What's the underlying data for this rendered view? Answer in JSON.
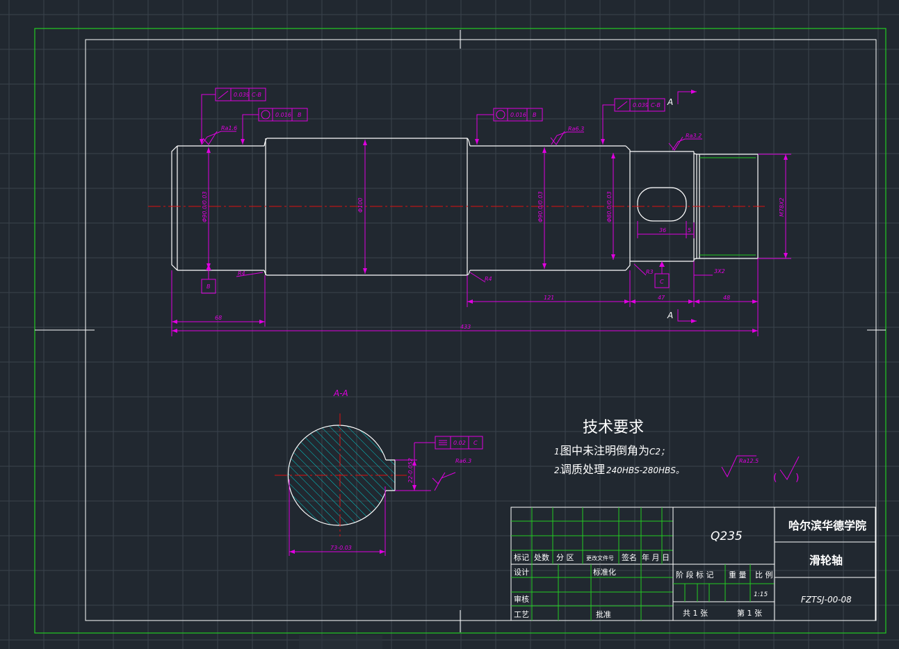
{
  "colors": {
    "background": "#212830",
    "grid": "#3a434d",
    "outer_frame": "#22cc22",
    "inner_frame": "#ffffff",
    "geometry": "#ffffff",
    "dimensions": "#e000e0",
    "centerline": "#dd1111",
    "hatch": "#00cccc",
    "title_block_lines": "#22cc22"
  },
  "labels": {
    "gtol_1_value": "0.039",
    "gtol_1_datum": "C-B",
    "gtol_2_value": "0.016",
    "gtol_2_datum": "B",
    "gtol_3_value": "0.016",
    "gtol_3_datum": "B",
    "gtol_4_value": "0.039",
    "gtol_4_datum": "C-B",
    "section_marker_top": "A",
    "section_marker_bottom": "A",
    "rough_1": "Ra1.6",
    "rough_2": "Ra6.3",
    "rough_3": "Ra3.2",
    "rough_4": "Ra6.3",
    "rough_5": "Ra12.5",
    "dia_1": "Φ90.0/0.03",
    "dia_2": "Φ100",
    "dia_3": "Φ90.0/0.03",
    "dia_4": "Φ80.0/0.03",
    "thread": "M78X2",
    "fillet_1": "R4",
    "fillet_2": "R4",
    "fillet_3": "R3",
    "datum_b": "B",
    "datum_c": "C",
    "len_68": "68",
    "len_433": "433",
    "len_121": "121",
    "len_47": "47",
    "len_48": "48",
    "len_36": "36",
    "len_5": "5",
    "groove": "3X2",
    "section_title": "A-A",
    "section_gtol_value": "0.02",
    "section_gtol_datum": "C",
    "section_key_dim": "22-0.052",
    "section_dia": "73-0.03",
    "tech_title": "技术要求",
    "tech_1_num": "1.",
    "tech_1_text": "图中未注明倒角为",
    "tech_1_val": "C2；",
    "tech_2_num": "2.",
    "tech_2_text": "调质处理",
    "tech_2_val": "240HBS-280HBS。",
    "rough_general_open": "(",
    "rough_general_close": ")"
  },
  "title_block": {
    "material": "Q235",
    "school": "哈尔滨华德学院",
    "part_name": "滑轮轴",
    "drawing_no": "FZTSJ-00-08",
    "col_headers": [
      "标记",
      "处数",
      "分 区",
      "更改文件号",
      "签名",
      "年 月 日"
    ],
    "design": "设计",
    "standardize": "标准化",
    "review": "审核",
    "process": "工艺",
    "approve": "批准",
    "stage_headers": [
      "阶 段 标 记",
      "重 量",
      "比 例"
    ],
    "scale": "1:15",
    "total_sheets": "共 1 张",
    "sheet_no": "第 1 张"
  }
}
